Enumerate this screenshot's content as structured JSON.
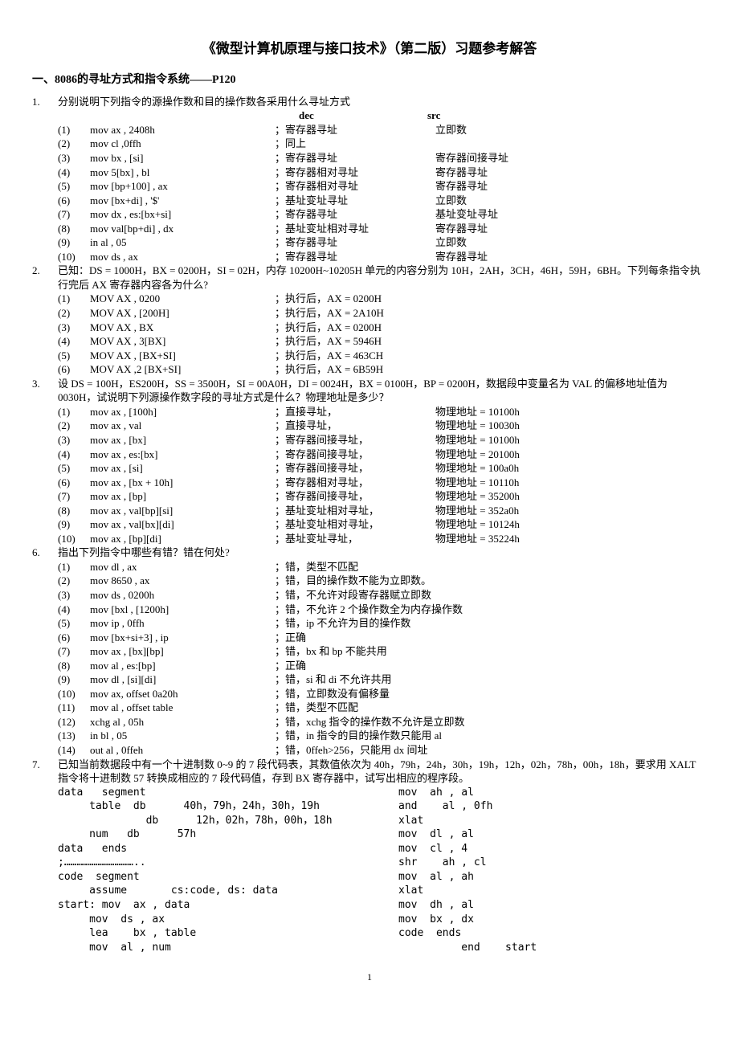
{
  "title": "《微型计算机原理与接口技术》（第二版）习题参考解答",
  "section": "一、8086的寻址方式和指令系统——P120",
  "q1": {
    "prompt": "分别说明下列指令的源操作数和目的操作数各采用什么寻址方式",
    "hdr_dec": "dec",
    "hdr_src": "src",
    "rows": [
      {
        "idx": "(1)",
        "instr": "mov  ax , 2408h",
        "dec": "；寄存器寻址",
        "src": "立即数"
      },
      {
        "idx": "(2)",
        "instr": "mov  cl ,0ffh",
        "dec": "；同上",
        "src": ""
      },
      {
        "idx": "(3)",
        "instr": "mov  bx , [si]",
        "dec": "；寄存器寻址",
        "src": "寄存器间接寻址"
      },
      {
        "idx": "(4)",
        "instr": "mov  5[bx] , bl",
        "dec": "；寄存器相对寻址",
        "src": "寄存器寻址"
      },
      {
        "idx": "(5)",
        "instr": "mov  [bp+100] , ax",
        "dec": "；寄存器相对寻址",
        "src": "寄存器寻址"
      },
      {
        "idx": "(6)",
        "instr": "mov  [bx+di] , '$'",
        "dec": "；基址变址寻址",
        "src": "立即数"
      },
      {
        "idx": "(7)",
        "instr": "mov  dx , es:[bx+si]",
        "dec": "；寄存器寻址",
        "src": "基址变址寻址"
      },
      {
        "idx": "(8)",
        "instr": "mov  val[bp+di] , dx",
        "dec": "；基址变址相对寻址",
        "src": "寄存器寻址"
      },
      {
        "idx": "(9)",
        "instr": "in     al , 05",
        "dec": "；寄存器寻址",
        "src": "立即数"
      },
      {
        "idx": "(10)",
        "instr": "mov  ds , ax",
        "dec": "；寄存器寻址",
        "src": "寄存器寻址"
      }
    ]
  },
  "q2": {
    "prompt": "已知：DS = 1000H，BX = 0200H，SI = 02H，内存 10200H~10205H 单元的内容分别为 10H，2AH，3CH，46H，59H，6BH。下列每条指令执行完后 AX 寄存器内容各为什么?",
    "rows": [
      {
        "idx": "(1)",
        "instr": "MOV       AX , 0200",
        "comm": "；执行后，AX = 0200H"
      },
      {
        "idx": "(2)",
        "instr": "MOV       AX , [200H]",
        "comm": "；执行后，AX = 2A10H"
      },
      {
        "idx": "(3)",
        "instr": "MOV       AX , BX",
        "comm": "；执行后，AX = 0200H"
      },
      {
        "idx": "(4)",
        "instr": "MOV       AX , 3[BX]",
        "comm": "；执行后，AX = 5946H"
      },
      {
        "idx": "(5)",
        "instr": "MOV       AX , [BX+SI]",
        "comm": "；执行后，AX = 463CH"
      },
      {
        "idx": "(6)",
        "instr": "MOV       AX ,2 [BX+SI]",
        "comm": "；执行后，AX = 6B59H"
      }
    ]
  },
  "q3": {
    "prompt": "设 DS = 100H，ES200H，SS = 3500H，SI = 00A0H，DI = 0024H，BX = 0100H，BP = 0200H，数据段中变量名为 VAL 的偏移地址值为 0030H，试说明下列源操作数字段的寻址方式是什么？物理地址是多少？",
    "rows": [
      {
        "idx": "(1)",
        "instr": "mov  ax , [100h]",
        "a": "；直接寻址，",
        "b": "物理地址 = 10100h"
      },
      {
        "idx": "(2)",
        "instr": "mov  ax , val",
        "a": "；直接寻址，",
        "b": "物理地址 = 10030h"
      },
      {
        "idx": "(3)",
        "instr": "mov  ax , [bx]",
        "a": "；寄存器间接寻址，",
        "b": "物理地址 = 10100h"
      },
      {
        "idx": "(4)",
        "instr": "mov  ax , es:[bx]",
        "a": "；寄存器间接寻址，",
        "b": "物理地址 = 20100h"
      },
      {
        "idx": "(5)",
        "instr": "mov  ax , [si]",
        "a": "；寄存器间接寻址，",
        "b": "物理地址 = 100a0h"
      },
      {
        "idx": "(6)",
        "instr": "mov  ax , [bx + 10h]",
        "a": "；寄存器相对寻址，",
        "b": "物理地址 = 10110h"
      },
      {
        "idx": "(7)",
        "instr": "mov  ax , [bp]",
        "a": "；寄存器间接寻址，",
        "b": "物理地址 = 35200h"
      },
      {
        "idx": "(8)",
        "instr": "mov  ax , val[bp][si]",
        "a": "；基址变址相对寻址，",
        "b": "物理地址 = 352a0h"
      },
      {
        "idx": "(9)",
        "instr": "mov  ax , val[bx][di]",
        "a": "；基址变址相对寻址，",
        "b": "物理地址 = 10124h"
      },
      {
        "idx": "(10)",
        "instr": "mov  ax , [bp][di]",
        "a": "；基址变址寻址，",
        "b": "物理地址 = 35224h"
      }
    ]
  },
  "q6": {
    "prompt": "指出下列指令中哪些有错？错在何处?",
    "rows": [
      {
        "idx": "(1)",
        "instr": "mov  dl , ax",
        "comm": "；错，类型不匹配"
      },
      {
        "idx": "(2)",
        "instr": "mov  8650 , ax",
        "comm": "；错，目的操作数不能为立即数。"
      },
      {
        "idx": "(3)",
        "instr": "mov  ds , 0200h",
        "comm": "；错，不允许对段寄存器赋立即数"
      },
      {
        "idx": "(4)",
        "instr": "mov  [bxl , [1200h]",
        "comm": "；错，不允许 2 个操作数全为内存操作数"
      },
      {
        "idx": "(5)",
        "instr": "mov  ip , 0ffh",
        "comm": "；错，ip 不允许为目的操作数"
      },
      {
        "idx": "(6)",
        "instr": "mov  [bx+si+3] , ip",
        "comm": "；正确"
      },
      {
        "idx": "(7)",
        "instr": "mov  ax , [bx][bp]",
        "comm": "；错，bx 和 bp 不能共用"
      },
      {
        "idx": "(8)",
        "instr": "mov  al , es:[bp]",
        "comm": "；正确"
      },
      {
        "idx": "(9)",
        "instr": "mov  dl , [si][di]",
        "comm": "；错，si 和 di 不允许共用"
      },
      {
        "idx": "(10)",
        "instr": "mov  ax, offset 0a20h",
        "comm": "；错，立即数没有偏移量"
      },
      {
        "idx": "(11)",
        "instr": "mov  al , offset table",
        "comm": "；错，类型不匹配"
      },
      {
        "idx": "(12)",
        "instr": "xchg   al , 05h",
        "comm": "；错，xchg 指令的操作数不允许是立即数"
      },
      {
        "idx": "(13)",
        "instr": "in     bl , 05",
        "comm": "；错，in 指令的目的操作数只能用 al"
      },
      {
        "idx": "(14)",
        "instr": "out   al , 0ffeh",
        "comm": "；错，0ffeh>256，只能用 dx 间址"
      }
    ]
  },
  "q7": {
    "prompt": "已知当前数据段中有一个十进制数 0~9 的 7 段代码表，其数值依次为 40h，79h，24h，30h，19h，12h，02h，78h，00h，18h，要求用 XALT 指令将十进制数 57 转换成相应的 7 段代码值，存到 BX 寄存器中，试写出相应的程序段。",
    "left": "data   segment\n     table  db      40h，79h，24h，30h，19h\n              db      12h，02h，78h，00h，18h\n     num   db      57h\ndata   ends\n;……………………………..\ncode  segment\n     assume       cs:code, ds: data\nstart: mov  ax , data\n     mov  ds , ax\n     lea    bx , table\n     mov  al , num",
    "right": "mov  ah , al\nand    al , 0fh\nxlat\nmov  dl , al\nmov  cl , 4\nshr    ah , cl\nmov  al , ah\nxlat\nmov  dh , al\nmov  bx , dx\ncode  ends\n          end    start"
  },
  "page_num": "1"
}
